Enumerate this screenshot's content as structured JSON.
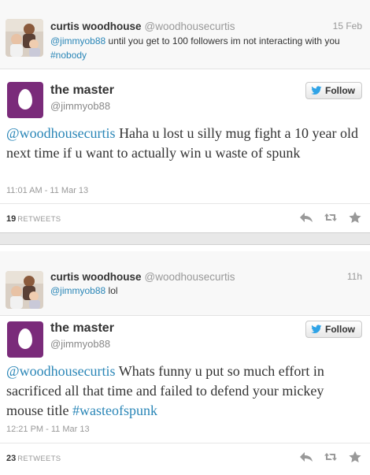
{
  "tweets": [
    {
      "context": {
        "name": "curtis woodhouse",
        "handle": "@woodhousecurtis",
        "time": "15 Feb",
        "mention": "@jimmyob88",
        "text": " until you get to 100 followers im not interacting with you",
        "hashtag": "#nobody"
      },
      "main": {
        "name": "the master",
        "handle": "@jimmyob88",
        "follow_label": "Follow",
        "mention": "@woodhousecurtis",
        "text": " Haha u lost u silly mug fight a 10 year old next time if u want to actually win u waste of spunk",
        "timestamp": "11:01 AM - 11 Mar 13",
        "retweets": "19",
        "retweets_label": "RETWEETS"
      }
    },
    {
      "context": {
        "name": "curtis woodhouse",
        "handle": "@woodhousecurtis",
        "time": "11h",
        "mention": "@jimmyob88",
        "text": " lol"
      },
      "main": {
        "name": "the master",
        "handle": "@jimmyob88",
        "follow_label": "Follow",
        "mention": "@woodhousecurtis",
        "text": " Whats funny u put so much effort in sacrificed all that time and failed to defend your mickey mouse title ",
        "hashtag": "#wasteofspunk",
        "timestamp": "12:21 PM - 11 Mar 13",
        "retweets": "23",
        "retweets_label": "RETWEETS"
      }
    }
  ],
  "icons": [
    "reply-icon",
    "retweet-icon",
    "favorite-icon",
    "twitter-bird-icon",
    "egg-avatar-icon"
  ],
  "colors": {
    "link": "#2a86b7",
    "egg_avatar_bg": "#7a2b7a",
    "context_bg": "#f8f8f8"
  }
}
